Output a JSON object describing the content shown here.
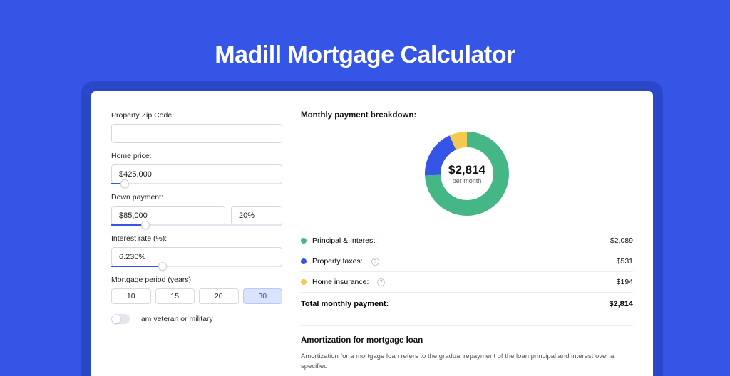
{
  "page": {
    "title": "Madill Mortgage Calculator"
  },
  "form": {
    "zip": {
      "label": "Property Zip Code:",
      "value": ""
    },
    "home_price": {
      "label": "Home price:",
      "value": "$425,000",
      "slider_pct": 8
    },
    "down_payment": {
      "label": "Down payment:",
      "amount": "$85,000",
      "pct": "20%",
      "slider_pct": 20
    },
    "interest_rate": {
      "label": "Interest rate (%):",
      "value": "6.230%",
      "slider_pct": 30
    },
    "period": {
      "label": "Mortgage period (years):",
      "options": [
        "10",
        "15",
        "20",
        "30"
      ],
      "selected": "30"
    },
    "veteran": {
      "label": "I am veteran or military",
      "checked": false
    }
  },
  "breakdown": {
    "title": "Monthly payment breakdown:",
    "center_amount": "$2,814",
    "center_sub": "per month",
    "items": [
      {
        "label": "Principal & Interest:",
        "value": "$2,089",
        "color": "green"
      },
      {
        "label": "Property taxes:",
        "value": "$531",
        "color": "blue",
        "info": true
      },
      {
        "label": "Home insurance:",
        "value": "$194",
        "color": "yellow",
        "info": true
      }
    ],
    "total_label": "Total monthly payment:",
    "total_value": "$2,814"
  },
  "chart_data": {
    "type": "pie",
    "title": "Monthly payment breakdown",
    "series": [
      {
        "name": "Principal & Interest",
        "value": 2089,
        "color": "#45b787"
      },
      {
        "name": "Property taxes",
        "value": 531,
        "color": "#3555e6"
      },
      {
        "name": "Home insurance",
        "value": 194,
        "color": "#f4c94f"
      }
    ],
    "total": 2814,
    "donut_inner_pct": 65
  },
  "amortization": {
    "title": "Amortization for mortgage loan",
    "text": "Amortization for a mortgage loan refers to the gradual repayment of the loan principal and interest over a specified"
  }
}
